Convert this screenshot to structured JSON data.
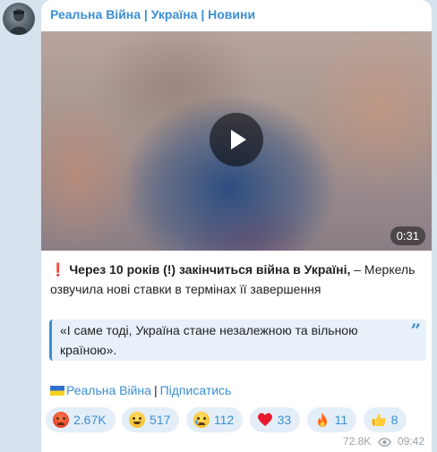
{
  "channel": {
    "name": "Реальна Війна | Україна | Новини"
  },
  "video": {
    "duration": "0:31"
  },
  "post": {
    "bold_text": "Через 10 років (!) закінчиться війна в Україні,",
    "regular_text": " – Меркель озвучила нові ставки в термінах її завершення",
    "quote": "«І саме тоді, Україна стане незалежною та вільною країною».",
    "channel_link": "Реальна Війна",
    "separator": "|",
    "subscribe_link": "Підписатись"
  },
  "reactions": [
    {
      "emoji": "angry-face-icon",
      "count": "2.67K"
    },
    {
      "emoji": "grinning-face-icon",
      "count": "517"
    },
    {
      "emoji": "crying-face-icon",
      "count": "112"
    },
    {
      "emoji": "red-heart-icon",
      "count": "33"
    },
    {
      "emoji": "fire-icon",
      "count": "11"
    },
    {
      "emoji": "thumbs-up-icon",
      "count": "8"
    }
  ],
  "meta": {
    "views": "72.8K",
    "time": "09:42"
  },
  "colors": {
    "accent": "#3a8fd4",
    "background": "#d6e2ee",
    "quote_background": "#e8f1fa",
    "reaction_background": "#e4eef8"
  }
}
